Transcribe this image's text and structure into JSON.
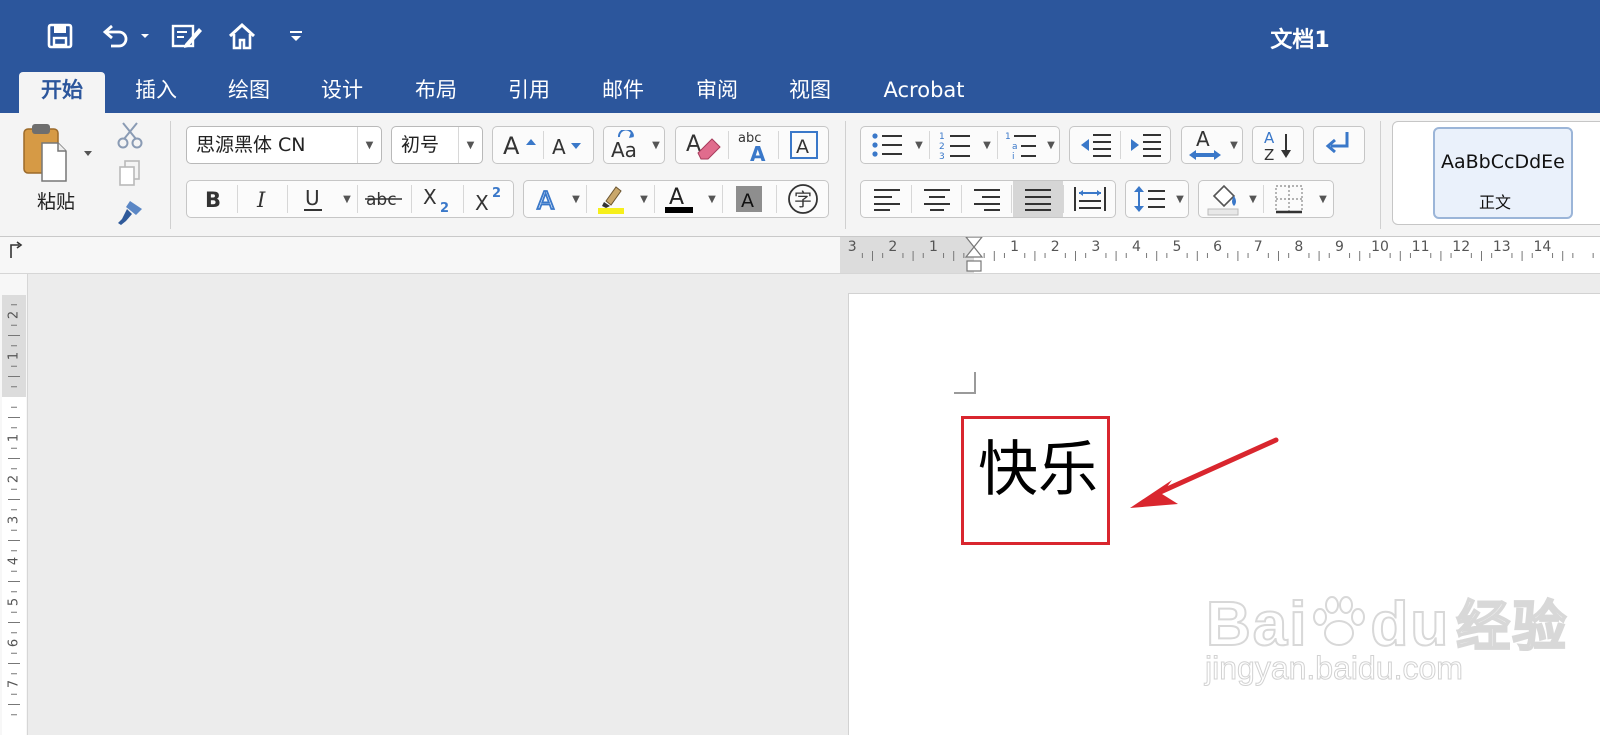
{
  "window": {
    "title": "文档1"
  },
  "tabs": [
    "开始",
    "插入",
    "绘图",
    "设计",
    "布局",
    "引用",
    "邮件",
    "审阅",
    "视图",
    "Acrobat"
  ],
  "clipboard": {
    "paste_label": "粘贴"
  },
  "font": {
    "name": "思源黑体 CN",
    "size": "初号",
    "font_color_letter": "A",
    "shading_letter": "A",
    "enclose_char": "字"
  },
  "styles": {
    "sample": "AaBbCcDdEe",
    "name": "正文"
  },
  "document": {
    "text": "快乐"
  },
  "rulers": {
    "horizontal": [
      "3",
      "2",
      "1",
      "1",
      "2",
      "3",
      "4",
      "5",
      "6",
      "7",
      "8",
      "9",
      "10",
      "11",
      "12",
      "13",
      "14"
    ],
    "vertical": [
      "2",
      "1",
      "1",
      "2",
      "3",
      "4",
      "5",
      "6",
      "7"
    ]
  },
  "watermark": {
    "logo_text": "Bai",
    "logo_text2": "du",
    "logo_cn": "经验",
    "url": "jingyan.baidu.com"
  },
  "colors": {
    "title_bar": "#2c569c",
    "highlight": "#f6ef1b",
    "font_color": "#000000",
    "annotation": "#d9262e"
  }
}
